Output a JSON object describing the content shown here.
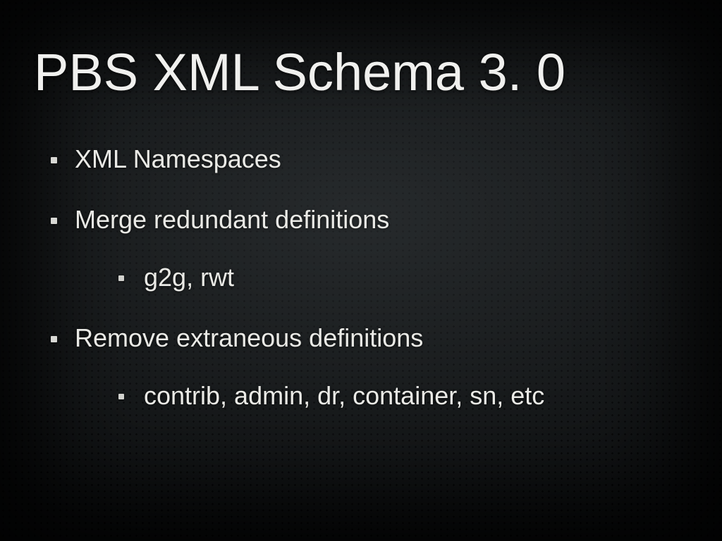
{
  "title": "PBS XML Schema 3. 0",
  "bullets": [
    {
      "text": "XML Namespaces"
    },
    {
      "text": "Merge redundant definitions",
      "children": [
        {
          "text": "g2g, rwt"
        }
      ]
    },
    {
      "text": "Remove extraneous definitions",
      "children": [
        {
          "text": "contrib, admin, dr, container, sn, etc"
        }
      ]
    }
  ]
}
